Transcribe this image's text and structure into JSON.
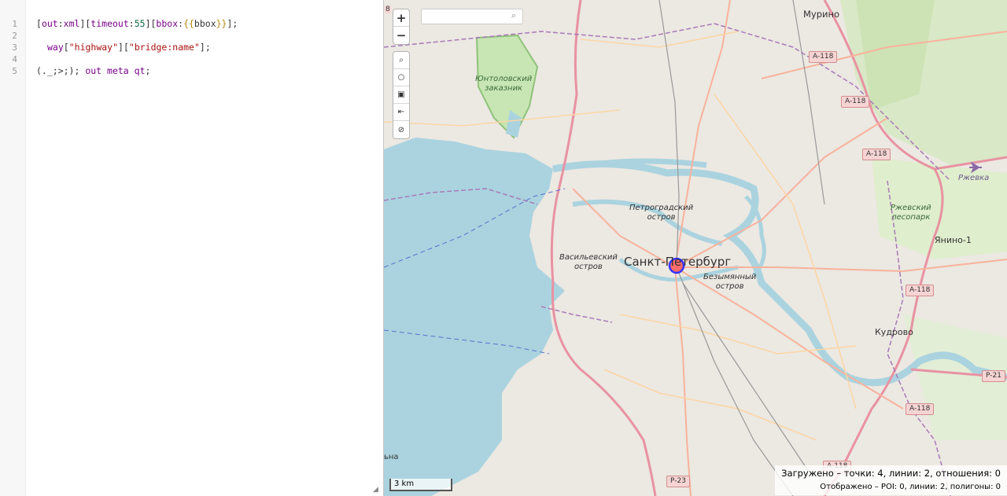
{
  "editor": {
    "line_numbers": [
      "1",
      "2",
      "3",
      "4",
      "5"
    ],
    "line1": {
      "open": "[",
      "out": "out",
      "colon1": ":",
      "xml": "xml",
      "close1": "][",
      "timeout": "timeout",
      "colon2": ":",
      "timeout_val": "55",
      "close2": "][",
      "bbox": "bbox",
      "colon3": ":",
      "brace_open": "{{",
      "bbox_var": "bbox",
      "brace_close": "}}",
      "close3": "];"
    },
    "line3": {
      "way": "way",
      "open1": "[",
      "key1": "\"highway\"",
      "mid": "][",
      "key2": "\"bridge:name\"",
      "close": "];"
    },
    "line5": {
      "recurse": "(._;>;);",
      "space": " ",
      "out_meta": "out meta qt",
      "end": ";"
    }
  },
  "map": {
    "zoom_in": "+",
    "zoom_out": "−",
    "tool_icons": [
      "magnifier-icon",
      "circle-icon",
      "image-icon",
      "first-icon",
      "block-icon"
    ],
    "tool_glyphs": [
      "⌕",
      "○",
      "▣",
      "⇤",
      "⊘"
    ],
    "search": {
      "placeholder": "",
      "value": ""
    },
    "scale_label": "3 km",
    "stats": {
      "loaded": "Загружено – точки: 4, линии: 2, отношения: 0",
      "displayed": "Отображено – POI: 0, линии: 2, полигоны: 0"
    },
    "labels": {
      "city": "Санкт-Петербург",
      "murino": "Мурино",
      "yuntolovsky": [
        "Юнтоловский",
        "заказник"
      ],
      "petrogradsky": [
        "Петроградский",
        "остров"
      ],
      "vasilyevsky": [
        "Васильевский",
        "остров"
      ],
      "bezymyanny": [
        "Безымянный",
        "остров"
      ],
      "rzhevka": "Ржевка",
      "rzhevsky": [
        "Ржевский",
        "лесопарк"
      ],
      "yanino": "Янино-1",
      "kudrovo": "Кудрово",
      "left_partial": "ьна",
      "top_partial": "8"
    },
    "shields": {
      "a118_1": "A-118",
      "a118_2": "A-118",
      "a118_3": "A-118",
      "a118_4": "A-118",
      "a118_5": "A-118",
      "a118_6": "A-118",
      "p21": "P-21",
      "p23": "P-23"
    },
    "colors": {
      "water": "#aad3df",
      "land": "#f2efe9",
      "motorway": "#e892a2",
      "trunk": "#f9b29c",
      "primary": "#fcd6a4",
      "marker": "#ff6b6b",
      "marker_stroke": "#3333ff"
    }
  }
}
